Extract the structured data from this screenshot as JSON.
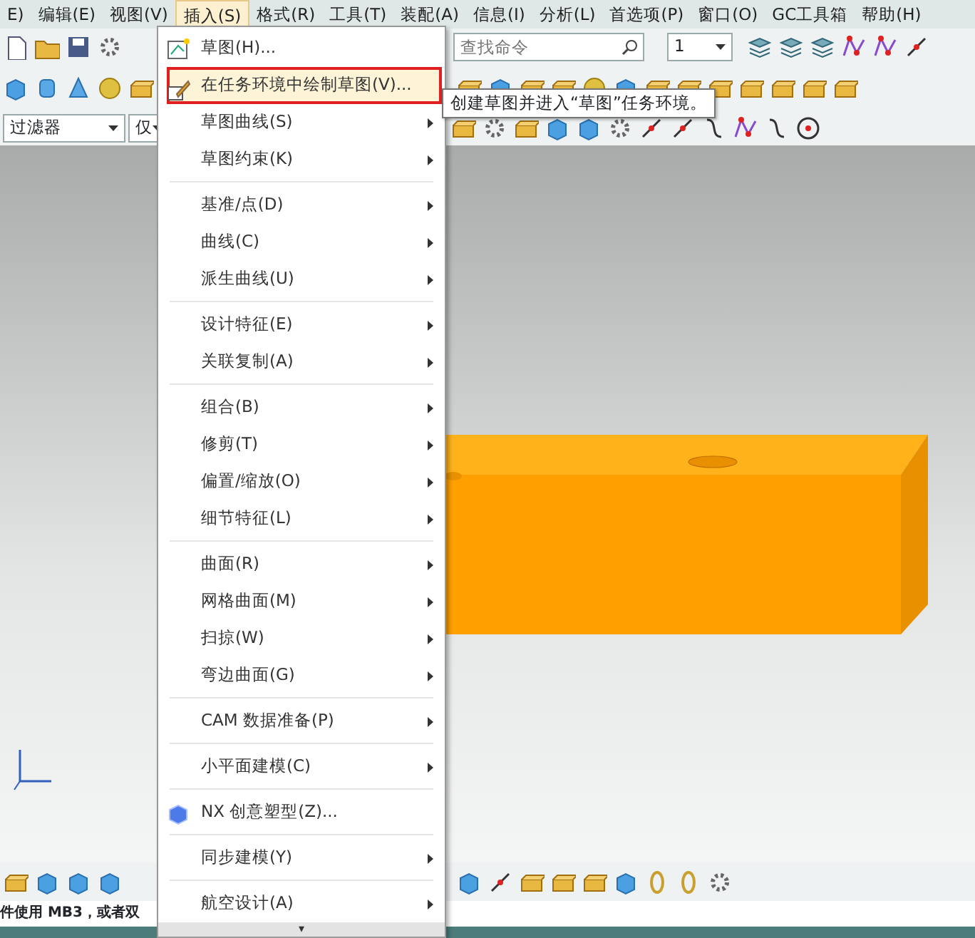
{
  "menubar": [
    {
      "label": "E)",
      "selected": false
    },
    {
      "label": "编辑(E)",
      "selected": false
    },
    {
      "label": "视图(V)",
      "selected": false
    },
    {
      "label": "插入(S)",
      "selected": true
    },
    {
      "label": "格式(R)",
      "selected": false
    },
    {
      "label": "工具(T)",
      "selected": false
    },
    {
      "label": "装配(A)",
      "selected": false
    },
    {
      "label": "信息(I)",
      "selected": false
    },
    {
      "label": "分析(L)",
      "selected": false
    },
    {
      "label": "首选项(P)",
      "selected": false
    },
    {
      "label": "窗口(O)",
      "selected": false
    },
    {
      "label": "GC工具箱",
      "selected": false
    },
    {
      "label": "帮助(H)",
      "selected": false
    }
  ],
  "toolbar": {
    "search": {
      "placeholder": "查找命令"
    },
    "layer_combo": {
      "value": "1"
    }
  },
  "filter_bar": {
    "type_filter": {
      "value": "过滤器"
    },
    "scope_filter": {
      "value": "仅"
    }
  },
  "insert_menu": {
    "items": [
      {
        "kind": "command",
        "label": "草图(H)...",
        "highlighted": false
      },
      {
        "kind": "command",
        "label": "在任务环境中绘制草图(V)...",
        "highlighted": true
      },
      {
        "kind": "submenu",
        "label": "草图曲线(S)",
        "highlighted": false
      },
      {
        "kind": "submenu",
        "label": "草图约束(K)",
        "highlighted": false
      },
      {
        "kind": "separator"
      },
      {
        "kind": "submenu",
        "label": "基准/点(D)",
        "highlighted": false
      },
      {
        "kind": "submenu",
        "label": "曲线(C)",
        "highlighted": false
      },
      {
        "kind": "submenu",
        "label": "派生曲线(U)",
        "highlighted": false
      },
      {
        "kind": "separator"
      },
      {
        "kind": "submenu",
        "label": "设计特征(E)",
        "highlighted": false
      },
      {
        "kind": "submenu",
        "label": "关联复制(A)",
        "highlighted": false
      },
      {
        "kind": "separator"
      },
      {
        "kind": "submenu",
        "label": "组合(B)",
        "highlighted": false
      },
      {
        "kind": "submenu",
        "label": "修剪(T)",
        "highlighted": false
      },
      {
        "kind": "submenu",
        "label": "偏置/缩放(O)",
        "highlighted": false
      },
      {
        "kind": "submenu",
        "label": "细节特征(L)",
        "highlighted": false
      },
      {
        "kind": "separator"
      },
      {
        "kind": "submenu",
        "label": "曲面(R)",
        "highlighted": false
      },
      {
        "kind": "submenu",
        "label": "网格曲面(M)",
        "highlighted": false
      },
      {
        "kind": "submenu",
        "label": "扫掠(W)",
        "highlighted": false
      },
      {
        "kind": "submenu",
        "label": "弯边曲面(G)",
        "highlighted": false
      },
      {
        "kind": "separator"
      },
      {
        "kind": "submenu",
        "label": "CAM 数据准备(P)",
        "highlighted": false
      },
      {
        "kind": "separator"
      },
      {
        "kind": "submenu",
        "label": "小平面建模(C)",
        "highlighted": false
      },
      {
        "kind": "separator"
      },
      {
        "kind": "command",
        "label": "NX 创意塑型(Z)...",
        "highlighted": false
      },
      {
        "kind": "separator"
      },
      {
        "kind": "submenu",
        "label": "同步建模(Y)",
        "highlighted": false
      },
      {
        "kind": "separator"
      },
      {
        "kind": "submenu",
        "label": "航空设计(A)",
        "highlighted": false
      }
    ],
    "more_arrow": "▾"
  },
  "tooltip": "创建草图并进入“草图”任务环境。",
  "status_text": "件使用 MB3，或者双"
}
